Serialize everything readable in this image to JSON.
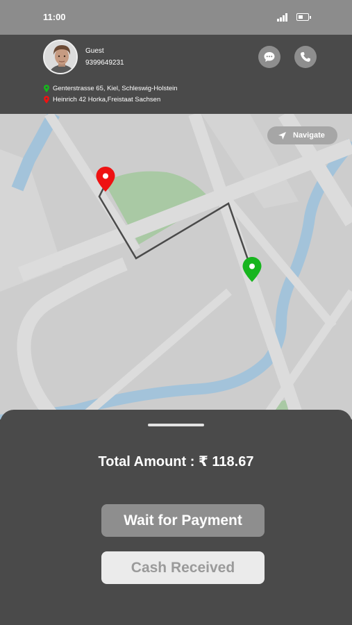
{
  "status_bar": {
    "time": "11:00",
    "signal_icon": "signal-icon",
    "battery_icon": "battery-icon"
  },
  "header": {
    "guest_name": "Guest",
    "guest_phone": "9399649231",
    "chat_icon": "chat-icon",
    "call_icon": "phone-icon",
    "pickup_address": "Genterstrasse 65, Kiel, Schleswig-Holstein",
    "drop_address": "Heinrich 42 Horka,Freistaat Sachsen"
  },
  "map": {
    "navigate_label": "Navigate",
    "navigate_icon": "navigation-arrow-icon",
    "pickup_pin_color": "#17b51e",
    "drop_pin_color": "#ee1212"
  },
  "sheet": {
    "total_amount": "Total Amount : ₹ 118.67",
    "wait_label": "Wait for Payment",
    "cash_label": "Cash Received"
  },
  "colors": {
    "status_bar": "#8c8c8c",
    "panel": "#4a4a4a",
    "map_bg": "#cdcdcd",
    "road": "#dcdcdc",
    "river": "#a3c3da",
    "park": "#a9c9a4",
    "button_grey": "#8e8e8e",
    "button_light": "#ebebeb"
  }
}
